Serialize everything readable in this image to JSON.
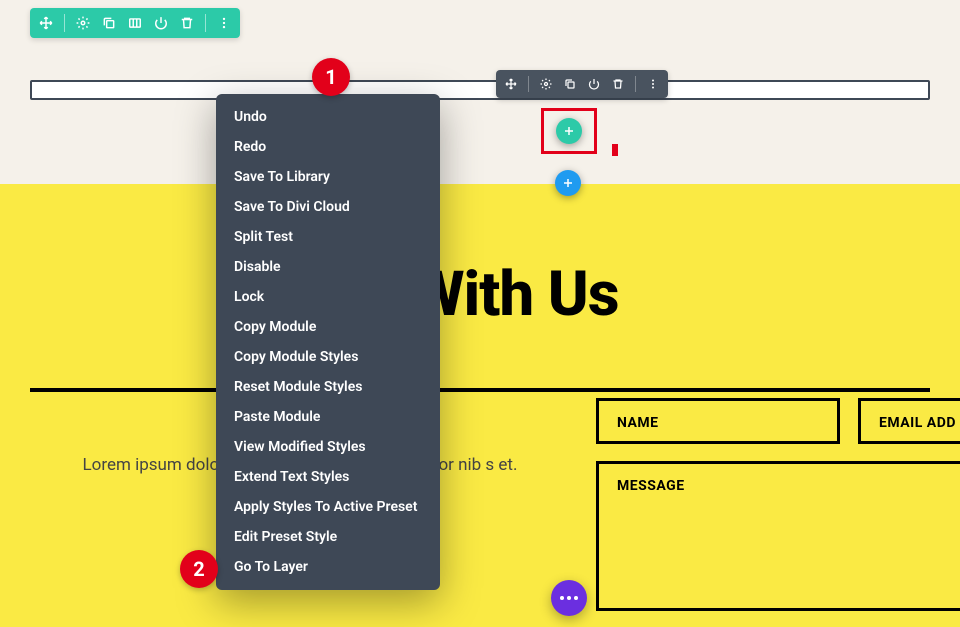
{
  "colors": {
    "teal": "#2ccaa8",
    "gray": "#49535f",
    "yellow": "#faea44",
    "red": "#e2001a",
    "blue": "#1f9bf0",
    "purple": "#6b2fe0"
  },
  "section_toolbar": {
    "icons": [
      "move",
      "settings",
      "duplicate",
      "columns",
      "power",
      "trash",
      "more"
    ]
  },
  "row_toolbar": {
    "icons": [
      "move",
      "settings",
      "duplicate",
      "power",
      "trash",
      "more"
    ]
  },
  "context_menu": {
    "items": [
      "Undo",
      "Redo",
      "Save To Library",
      "Save To Divi Cloud",
      "Split Test",
      "Disable",
      "Lock",
      "Copy Module",
      "Copy Module Styles",
      "Reset Module Styles",
      "Paste Module",
      "View Modified Styles",
      "Extend Text Styles",
      "Apply Styles To Active Preset",
      "Edit Preset Style",
      "Go To Layer"
    ]
  },
  "badges": {
    "one": "1",
    "two": "2"
  },
  "headline": "rk With Us",
  "paragraph": "Lorem ipsum dolor sit a                                                              t. Maecenas varius tortor nib                                               s et.",
  "form": {
    "name_label": "NAME",
    "email_label": "EMAIL ADD",
    "message_label": "MESSAGE"
  }
}
